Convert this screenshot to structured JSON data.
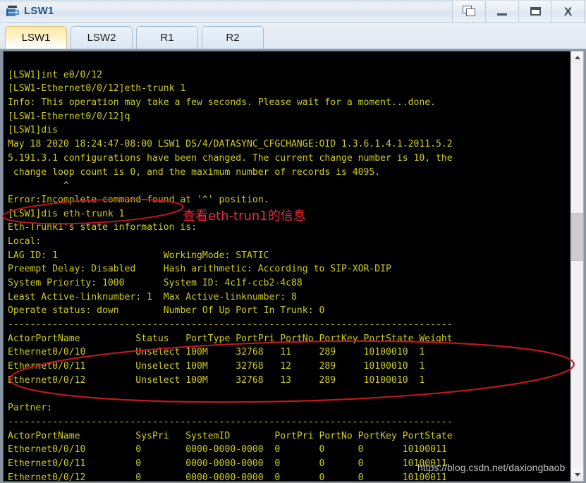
{
  "window": {
    "title": "LSW1",
    "icon": "switch-icon",
    "controls": [
      {
        "name": "cascade-button",
        "glyph": "cascade-icon",
        "label": "Restore"
      },
      {
        "name": "minimize-button",
        "glyph": "minimize-icon",
        "label": "_"
      },
      {
        "name": "maximize-button",
        "glyph": "maximize-icon",
        "label": "□"
      },
      {
        "name": "close-button",
        "glyph": "close-icon",
        "label": "X"
      }
    ]
  },
  "tabs": [
    {
      "label": "LSW1",
      "active": true
    },
    {
      "label": "LSW2",
      "active": false
    },
    {
      "label": "R1",
      "active": false
    },
    {
      "label": "R2",
      "active": false
    }
  ],
  "terminal": {
    "fg_color": "#cccc22",
    "bg_color": "#000000",
    "lines": [
      "",
      "[LSW1]int e0/0/12",
      "[LSW1-Ethernet0/0/12]eth-trunk 1",
      "Info: This operation may take a few seconds. Please wait for a moment...done.",
      "[LSW1-Ethernet0/0/12]q",
      "[LSW1]dis",
      "May 18 2020 18:24:47-08:00 LSW1 DS/4/DATASYNC_CFGCHANGE:OID 1.3.6.1.4.1.2011.5.2",
      "5.191.3.1 configurations have been changed. The current change number is 10, the",
      " change loop count is 0, and the maximum number of records is 4095.",
      "          ^",
      "Error:Incomplete command found at '^' position.",
      "[LSW1]dis eth-trunk 1",
      "Eth-Trunk1's state information is:",
      "Local:",
      "LAG ID: 1                   WorkingMode: STATIC",
      "Preempt Delay: Disabled     Hash arithmetic: According to SIP-XOR-DIP",
      "System Priority: 1000       System ID: 4c1f-ccb2-4c88",
      "Least Active-linknumber: 1  Max Active-linknumber: 8",
      "Operate status: down        Number Of Up Port In Trunk: 0",
      "--------------------------------------------------------------------------------",
      "ActorPortName          Status   PortType PortPri PortNo PortKey PortState Weight",
      "Ethernet0/0/10         Unselect 100M     32768   11     289     10100010  1",
      "Ethernet0/0/11         Unselect 100M     32768   12     289     10100010  1",
      "Ethernet0/0/12         Unselect 100M     32768   13     289     10100010  1",
      "",
      "Partner:",
      "--------------------------------------------------------------------------------",
      "ActorPortName          SysPri   SystemID        PortPri PortNo PortKey PortState",
      "Ethernet0/0/10         0        0000-0000-0000  0       0      0       10100011",
      "Ethernet0/0/11         0        0000-0000-0000  0       0      0       10100011",
      "Ethernet0/0/12         0        0000-0000-0000  0       0      0       10100011"
    ]
  },
  "annotations": {
    "color": "#c01620",
    "note_color": "#f2293a",
    "command_note": "查看eth-trun1的信息",
    "ellipse_command": "highlights command [LSW1]dis eth-trunk 1",
    "ellipse_table": "highlights the three Ethernet0/0/1x rows"
  },
  "watermark": {
    "text": "https://blog.csdn.net/daxiongbaob"
  },
  "scrollbar": {
    "up_arrow": "chevron-up-icon",
    "down_arrow": "chevron-down-icon",
    "thumb_position": "middle"
  }
}
